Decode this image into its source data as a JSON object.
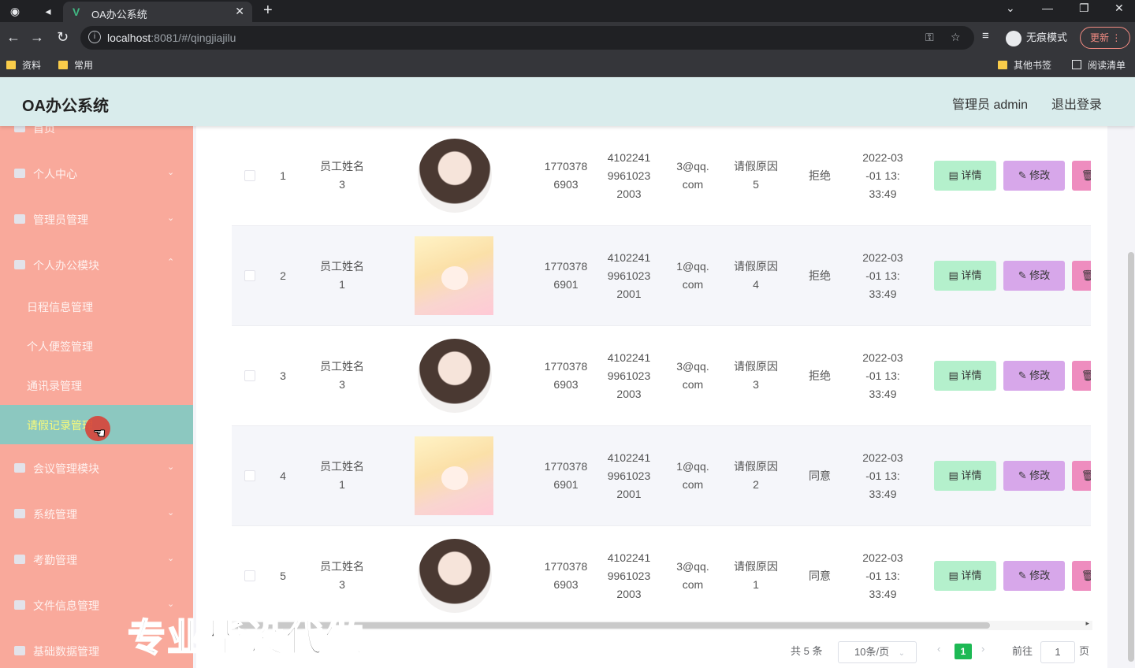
{
  "browser": {
    "tab_title": "OA办公系统",
    "tab_logo": "V",
    "url_host": "localhost",
    "url_rest": ":8081/#/qingjiajilu",
    "incognito_label": "无痕模式",
    "update_label": "更新",
    "bookmarks": [
      "资料",
      "常用"
    ],
    "other_bookmarks": "其他书签",
    "reading_list": "阅读清单"
  },
  "header": {
    "title": "OA办公系统",
    "user": "管理员 admin",
    "logout": "退出登录"
  },
  "sidebar": {
    "items": [
      {
        "label": "首页",
        "icon": "home-icon"
      },
      {
        "label": "个人中心",
        "icon": "user-icon"
      },
      {
        "label": "管理员管理",
        "icon": "admin-icon"
      },
      {
        "label": "个人办公模块",
        "icon": "office-icon"
      },
      {
        "label": "会议管理模块",
        "icon": "meeting-icon"
      },
      {
        "label": "系统管理",
        "icon": "system-icon"
      },
      {
        "label": "考勤管理",
        "icon": "attendance-icon"
      },
      {
        "label": "文件信息管理",
        "icon": "file-icon"
      },
      {
        "label": "基础数据管理",
        "icon": "chart-icon"
      }
    ],
    "sub_items": [
      "日程信息管理",
      "个人便签管理",
      "通讯录管理",
      "请假记录管理"
    ]
  },
  "table": {
    "rows": [
      {
        "index": "1",
        "name": "员工姓名3",
        "phone": "17703786903",
        "idcard": "410224199610232003",
        "email": "3@qq.com",
        "reason": "请假原因5",
        "status": "拒绝",
        "time": "2022-03-01 13:33:49",
        "avatar": "girl"
      },
      {
        "index": "2",
        "name": "员工姓名1",
        "phone": "17703786901",
        "idcard": "410224199610232001",
        "email": "1@qq.com",
        "reason": "请假原因4",
        "status": "拒绝",
        "time": "2022-03-01 13:33:49",
        "avatar": "anime"
      },
      {
        "index": "3",
        "name": "员工姓名3",
        "phone": "17703786903",
        "idcard": "410224199610232003",
        "email": "3@qq.com",
        "reason": "请假原因3",
        "status": "拒绝",
        "time": "2022-03-01 13:33:49",
        "avatar": "girl"
      },
      {
        "index": "4",
        "name": "员工姓名1",
        "phone": "17703786901",
        "idcard": "410224199610232001",
        "email": "1@qq.com",
        "reason": "请假原因2",
        "status": "同意",
        "time": "2022-03-01 13:33:49",
        "avatar": "anime"
      },
      {
        "index": "5",
        "name": "员工姓名3",
        "phone": "17703786903",
        "idcard": "410224199610232003",
        "email": "3@qq.com",
        "reason": "请假原因1",
        "status": "同意",
        "time": "2022-03-01 13:33:49",
        "avatar": "girl"
      }
    ],
    "actions": {
      "detail": "详情",
      "edit": "修改"
    }
  },
  "pagination": {
    "total": "共 5 条",
    "page_size": "10条/页",
    "current": "1",
    "goto_prefix": "前往",
    "goto_value": "1",
    "goto_suffix": "页"
  },
  "watermark": "专业毕设代做"
}
